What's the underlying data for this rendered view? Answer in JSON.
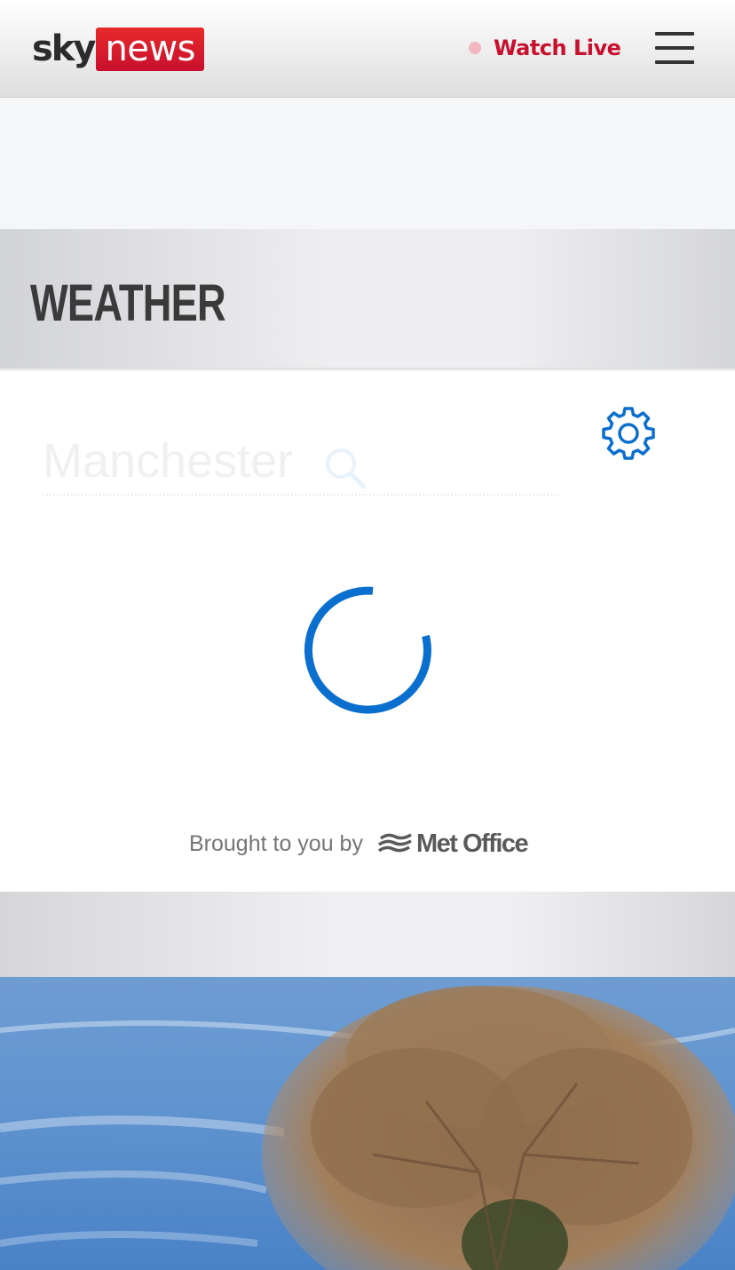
{
  "header": {
    "logo_sky": "sky",
    "logo_news": "news",
    "watch_live_label": "Watch Live",
    "menu_icon": "hamburger-menu-icon"
  },
  "section": {
    "title": "WEATHER"
  },
  "weather": {
    "search_placeholder": "Manchester",
    "search_value": "",
    "search_icon": "search-icon",
    "settings_icon": "gear-icon",
    "loading_icon": "loading-spinner",
    "attribution_label": "Brought to you by",
    "attribution_brand": "Met Office",
    "attribution_icon": "met-office-waves-icon"
  },
  "colors": {
    "brand_red": "#c8102e",
    "accent_blue": "#0a6fce",
    "live_dot": "#f3b7c0"
  },
  "image": {
    "description_icon": "tree-photo"
  }
}
